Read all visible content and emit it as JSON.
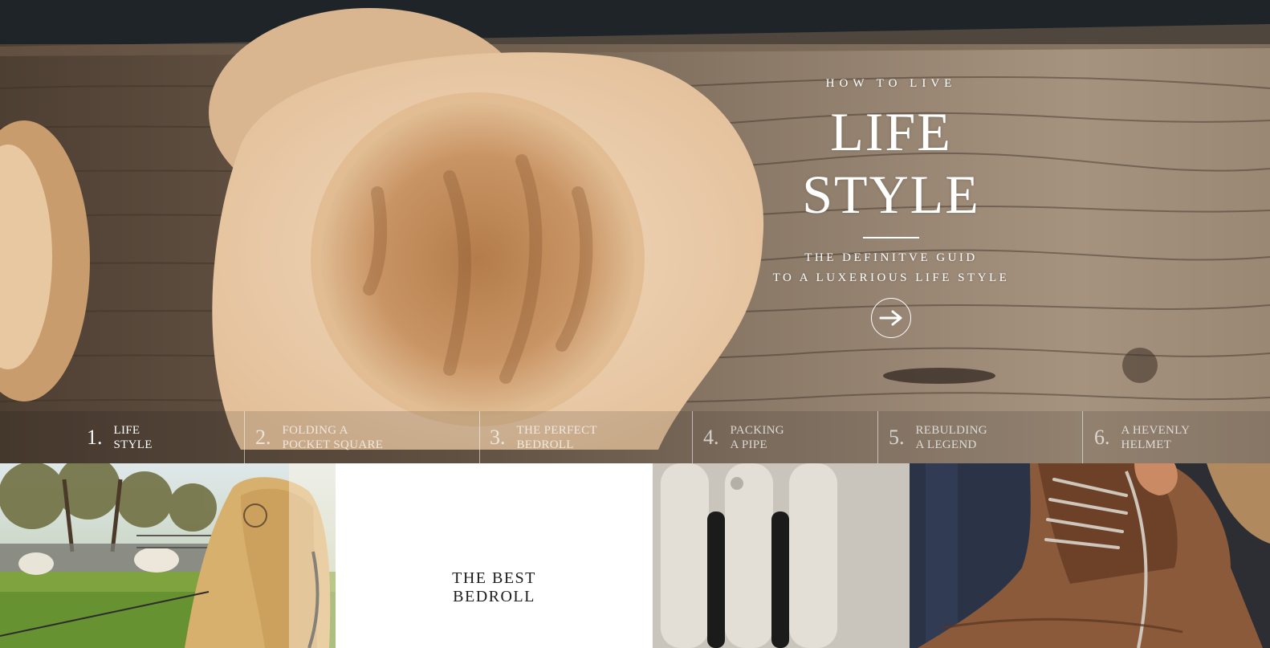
{
  "hero": {
    "kicker": "HOW TO LIVE",
    "title_line1": "LIFE",
    "title_line2": "STYLE",
    "subtitle_line1": "THE DEFINITVE GUID",
    "subtitle_line2": "TO A LUXERIOUS LIFE STYLE",
    "cta_icon": "arrow-right-icon"
  },
  "chapters": [
    {
      "number": "1.",
      "line1": "LIFE",
      "line2": "STYLE"
    },
    {
      "number": "2.",
      "line1": "FOLDING A",
      "line2": "POCKET SQUARE"
    },
    {
      "number": "3.",
      "line1": "THE PERFECT",
      "line2": "BEDROLL"
    },
    {
      "number": "4.",
      "line1": "PACKING",
      "line2": "A PIPE"
    },
    {
      "number": "5.",
      "line1": "REBULDING",
      "line2": "A LEGEND"
    },
    {
      "number": "6.",
      "line1": "A HEVENLY",
      "line2": "HELMET"
    }
  ],
  "tiles": {
    "center_title_line1": "THE BEST",
    "center_title_line2": "BEDROLL"
  },
  "colors": {
    "wood_dark": "#5c4a3a",
    "wood_light": "#b9a794",
    "bowl": "#e8c9a5",
    "text": "#ffffff"
  }
}
